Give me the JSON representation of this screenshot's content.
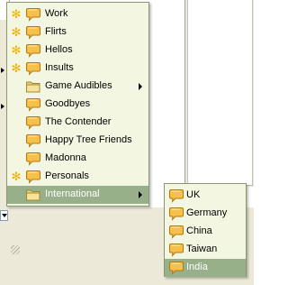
{
  "menu": {
    "items": [
      {
        "label": "Work",
        "icon": "speech-bubble-icon",
        "new": true
      },
      {
        "label": "Flirts",
        "icon": "speech-bubble-icon",
        "new": true
      },
      {
        "label": "Hellos",
        "icon": "speech-bubble-icon",
        "new": true
      },
      {
        "label": "Insults",
        "icon": "speech-bubble-icon",
        "new": true
      },
      {
        "label": "Game Audibles",
        "icon": "folder-icon",
        "new": false,
        "submenu": true
      },
      {
        "label": "Goodbyes",
        "icon": "speech-bubble-icon",
        "new": false
      },
      {
        "label": "The Contender",
        "icon": "speech-bubble-icon",
        "new": false
      },
      {
        "label": "Happy Tree Friends",
        "icon": "speech-bubble-icon",
        "new": false
      },
      {
        "label": "Madonna",
        "icon": "speech-bubble-icon",
        "new": false
      },
      {
        "label": "Personals",
        "icon": "speech-bubble-icon",
        "new": true
      },
      {
        "label": "International",
        "icon": "folder-icon",
        "new": false,
        "submenu": true,
        "selected": true
      }
    ]
  },
  "submenu": {
    "parent": "International",
    "items": [
      {
        "label": "UK",
        "icon": "speech-bubble-icon"
      },
      {
        "label": "Germany",
        "icon": "speech-bubble-icon"
      },
      {
        "label": "China",
        "icon": "speech-bubble-icon"
      },
      {
        "label": "Taiwan",
        "icon": "speech-bubble-icon"
      },
      {
        "label": "India",
        "icon": "speech-bubble-icon",
        "selected": true
      }
    ]
  },
  "colors": {
    "menu_bg": "#f3f7e2",
    "highlight": "#98b08a",
    "star": "#f0b000",
    "bubble": "#f7c04a"
  }
}
